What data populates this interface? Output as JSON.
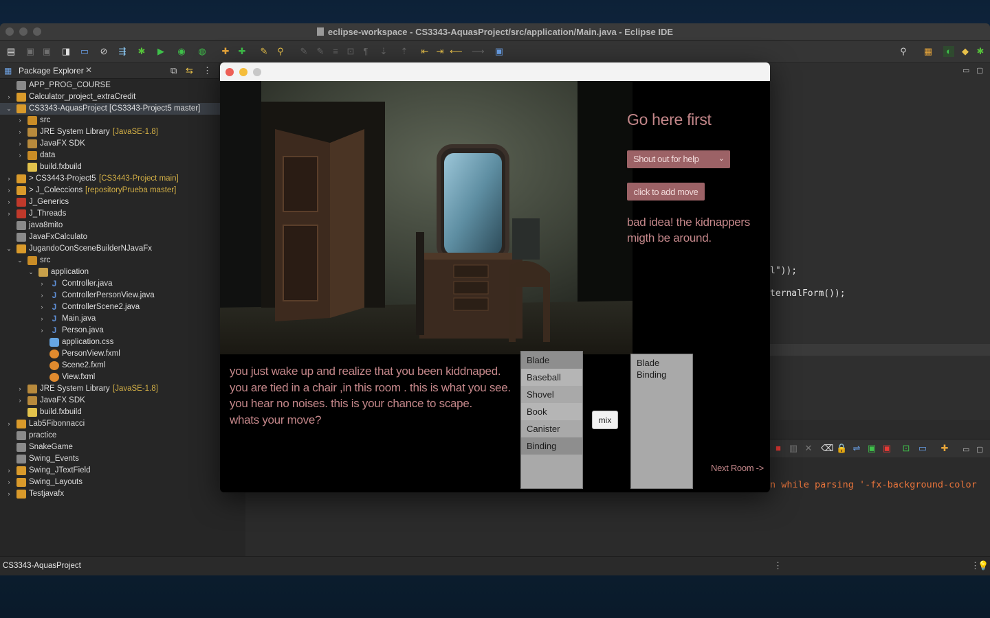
{
  "eclipse": {
    "title": "eclipse-workspace - CS3343-AquasProject/src/application/Main.java - Eclipse IDE",
    "package_explorer": {
      "tab_label": "Package Explorer",
      "tree": [
        {
          "label": "APP_PROG_COURSE",
          "deco": "",
          "arrow": "",
          "icon": "folder"
        },
        {
          "label": "Calculator_project_extraCredit",
          "deco": "",
          "arrow": "›",
          "icon": "project"
        },
        {
          "label": "CS3343-AquasProject [CS3343-Project5 master]",
          "deco": "",
          "arrow": "⌄",
          "icon": "project",
          "selected": true
        },
        {
          "label": "src",
          "deco": "",
          "arrow": "›",
          "icon": "src"
        },
        {
          "label": "JRE System Library",
          "deco": "[JavaSE-1.8]",
          "arrow": "›",
          "icon": "lib"
        },
        {
          "label": "JavaFX SDK",
          "deco": "",
          "arrow": "›",
          "icon": "lib"
        },
        {
          "label": "data",
          "deco": "",
          "arrow": "›",
          "icon": "src"
        },
        {
          "label": "build.fxbuild",
          "deco": "",
          "arrow": "",
          "icon": "build"
        },
        {
          "label": "> CS3443-Project5",
          "deco": "[CS3443-Project main]",
          "arrow": "›",
          "icon": "project"
        },
        {
          "label": "> J_Coleccions",
          "deco": "[repositoryPrueba master]",
          "arrow": "›",
          "icon": "project"
        },
        {
          "label": "J_Generics",
          "deco": "",
          "arrow": "›",
          "icon": "proj-red"
        },
        {
          "label": "J_Threads",
          "deco": "",
          "arrow": "›",
          "icon": "proj-red"
        },
        {
          "label": "java8mito",
          "deco": "",
          "arrow": "",
          "icon": "folder"
        },
        {
          "label": "JavaFxCalculato",
          "deco": "",
          "arrow": "",
          "icon": "folder"
        },
        {
          "label": "JugandoConSceneBuilderNJavaFx",
          "deco": "",
          "arrow": "⌄",
          "icon": "project"
        },
        {
          "label": "src",
          "deco": "",
          "arrow": "⌄",
          "icon": "src"
        },
        {
          "label": "application",
          "deco": "",
          "arrow": "⌄",
          "icon": "pkg"
        },
        {
          "label": "Controller.java",
          "deco": "",
          "arrow": "›",
          "icon": "java"
        },
        {
          "label": "ControllerPersonView.java",
          "deco": "",
          "arrow": "›",
          "icon": "java"
        },
        {
          "label": "ControllerScene2.java",
          "deco": "",
          "arrow": "›",
          "icon": "java"
        },
        {
          "label": "Main.java",
          "deco": "",
          "arrow": "›",
          "icon": "java"
        },
        {
          "label": "Person.java",
          "deco": "",
          "arrow": "›",
          "icon": "java"
        },
        {
          "label": "application.css",
          "deco": "",
          "arrow": "",
          "icon": "css"
        },
        {
          "label": "PersonView.fxml",
          "deco": "",
          "arrow": "",
          "icon": "fxml"
        },
        {
          "label": "Scene2.fxml",
          "deco": "",
          "arrow": "",
          "icon": "fxml"
        },
        {
          "label": "View.fxml",
          "deco": "",
          "arrow": "",
          "icon": "fxml"
        },
        {
          "label": "JRE System Library",
          "deco": "[JavaSE-1.8]",
          "arrow": "›",
          "icon": "lib"
        },
        {
          "label": "JavaFX SDK",
          "deco": "",
          "arrow": "›",
          "icon": "lib"
        },
        {
          "label": "build.fxbuild",
          "deco": "",
          "arrow": "",
          "icon": "build"
        },
        {
          "label": "Lab5Fibonnacci",
          "deco": "",
          "arrow": "›",
          "icon": "project"
        },
        {
          "label": "practice",
          "deco": "",
          "arrow": "",
          "icon": "folder"
        },
        {
          "label": "SnakeGame",
          "deco": "",
          "arrow": "",
          "icon": "folder"
        },
        {
          "label": "Swing_Events",
          "deco": "",
          "arrow": "",
          "icon": "folder"
        },
        {
          "label": "Swing_JTextField",
          "deco": "",
          "arrow": "›",
          "icon": "project"
        },
        {
          "label": "Swing_Layouts",
          "deco": "",
          "arrow": "›",
          "icon": "project"
        },
        {
          "label": "Testjavafx",
          "deco": "",
          "arrow": "›",
          "icon": "project"
        }
      ]
    },
    "editor": {
      "code_line_1": "l\"));",
      "code_line_2": "ternalForm());"
    },
    "console": {
      "error_text": "n while parsing '-fx-background-color"
    },
    "status": {
      "text": "CS3343-AquasProject"
    }
  },
  "game": {
    "heading": "Go here first",
    "move_select": "Shout out for help",
    "add_move_button": "click to add move",
    "feedback": "bad idea! the kidnappers\n migth be around.",
    "story_lines": [
      "you just wake up and realize that you been kiddnaped.",
      "you are tied in a chair ,in this room . this is what you see.",
      "you hear no noises. this is your chance to scape.",
      "whats your move?"
    ],
    "inventory": [
      "Blade",
      "Baseball",
      "Shovel",
      "Book",
      "Canister",
      "Binding"
    ],
    "mix_button": "mix",
    "mix_list": [
      "Blade",
      "Binding"
    ],
    "next_room": "Next Room ->"
  }
}
